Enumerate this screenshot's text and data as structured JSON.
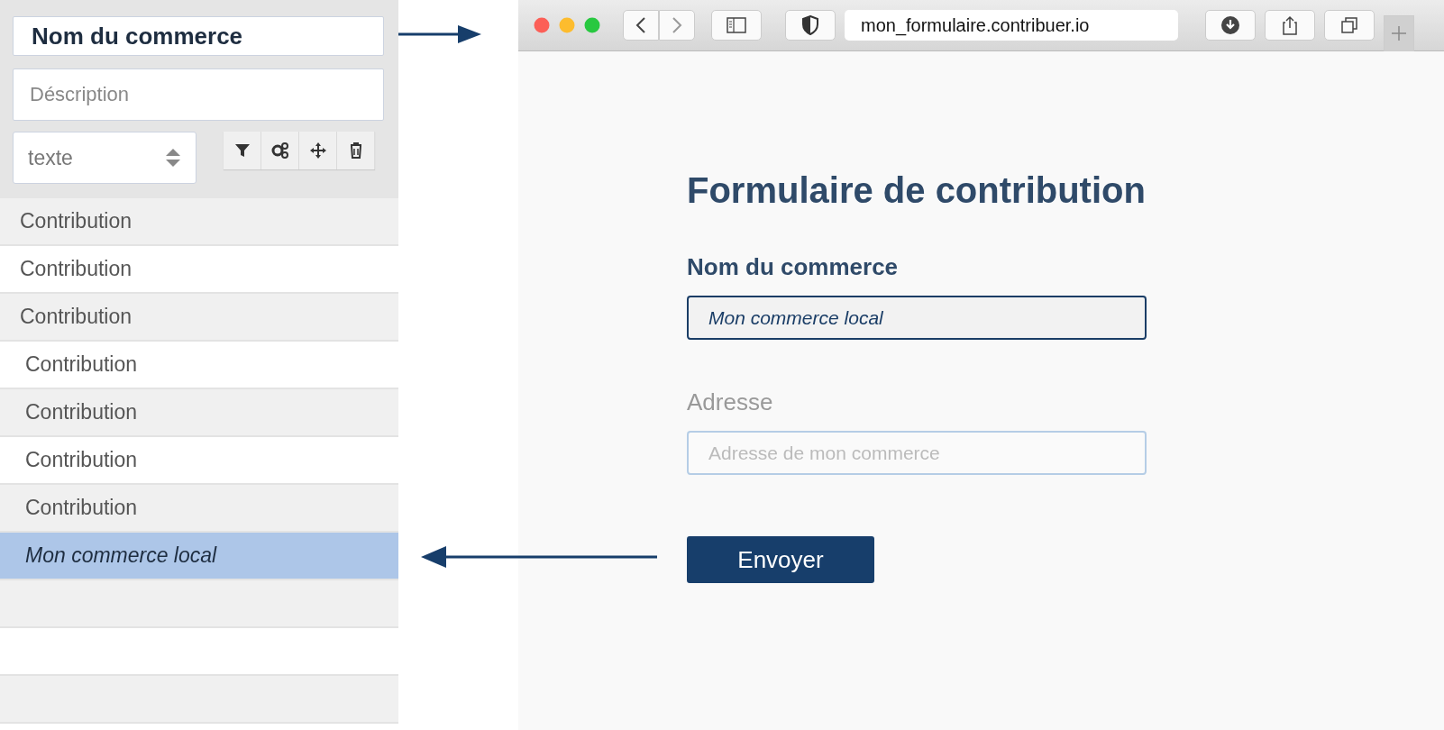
{
  "editor": {
    "title_field": {
      "value": "Nom du commerce"
    },
    "description_field": {
      "placeholder": "Déscription"
    },
    "type_select": {
      "value": "texte"
    },
    "rows": [
      {
        "label": "Contribution",
        "selected": false
      },
      {
        "label": "Contribution",
        "selected": false
      },
      {
        "label": "Contribution",
        "selected": false
      },
      {
        "label": "Contribution",
        "selected": false
      },
      {
        "label": "Contribution",
        "selected": false
      },
      {
        "label": "Contribution",
        "selected": false
      },
      {
        "label": "Contribution",
        "selected": false
      },
      {
        "label": "Mon commerce local",
        "selected": true
      },
      {
        "selected": false
      },
      {
        "selected": false
      },
      {
        "selected": false
      }
    ]
  },
  "browser": {
    "url": "mon_formulaire.contribuer.io",
    "form": {
      "title": "Formulaire de contribution",
      "fields": [
        {
          "label": "Nom du commerce",
          "value": "Mon commerce local",
          "active": true
        },
        {
          "label": "Adresse",
          "placeholder": "Adresse de mon commerce",
          "active": false
        }
      ],
      "submit": "Envoyer"
    }
  }
}
